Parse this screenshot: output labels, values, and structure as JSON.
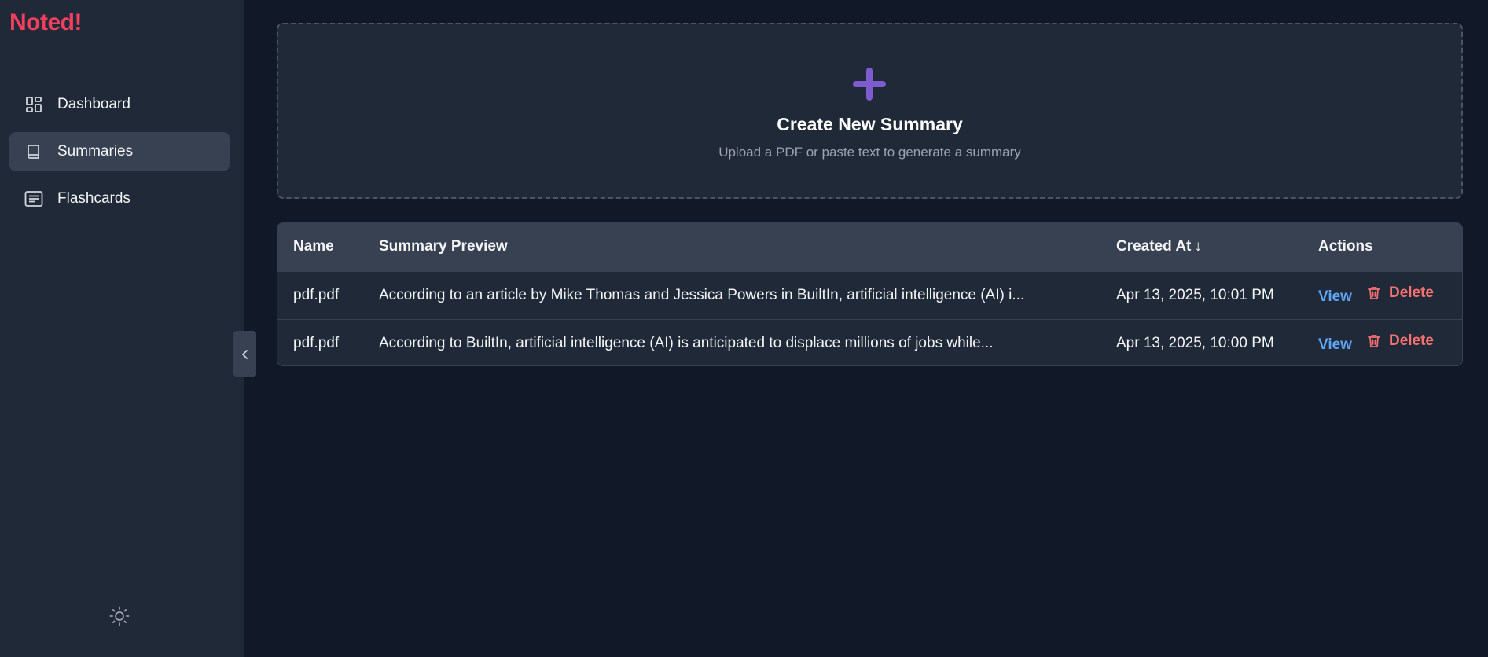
{
  "app": {
    "logo": "Noted!",
    "accent": "#f43f5e"
  },
  "sidebar": {
    "items": [
      {
        "label": "Dashboard",
        "icon": "dashboard-icon",
        "active": false
      },
      {
        "label": "Summaries",
        "icon": "book-icon",
        "active": true
      },
      {
        "label": "Flashcards",
        "icon": "card-list-icon",
        "active": false
      }
    ],
    "theme_toggle_icon": "sun-icon",
    "collapse_icon": "chevron-left-icon"
  },
  "upload": {
    "icon": "plus-icon",
    "icon_color": "#7c5ccf",
    "title": "Create New Summary",
    "subtitle": "Upload a PDF or paste text to generate a summary"
  },
  "table": {
    "headers": {
      "name": "Name",
      "preview": "Summary Preview",
      "created": "Created At",
      "sort_indicator": "↓",
      "actions": "Actions"
    },
    "rows": [
      {
        "name": "pdf.pdf",
        "preview": "According to an article by Mike Thomas and Jessica Powers in BuiltIn, artificial intelligence (AI) i...",
        "created": "Apr 13, 2025, 10:01 PM",
        "view": "View",
        "delete": "Delete"
      },
      {
        "name": "pdf.pdf",
        "preview": "According to BuiltIn, artificial intelligence (AI) is anticipated to displace millions of jobs while...",
        "created": "Apr 13, 2025, 10:00 PM",
        "view": "View",
        "delete": "Delete"
      }
    ]
  }
}
